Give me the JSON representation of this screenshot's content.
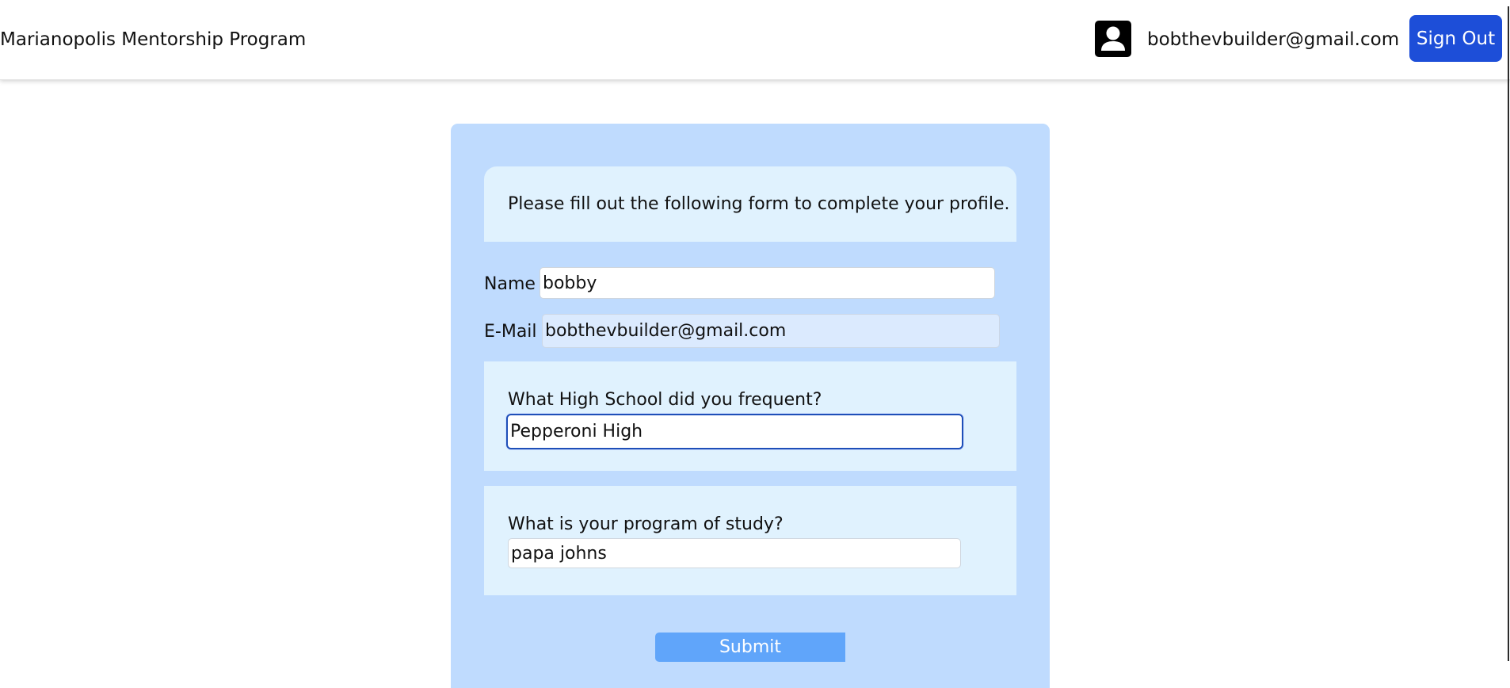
{
  "header": {
    "app_title": "Marianopolis Mentorship Program",
    "user_icon": "user-avatar-icon",
    "user_email": "bobthevbuilder@gmail.com",
    "sign_out_label": "Sign Out",
    "sign_out_color": "#1d4ed8"
  },
  "form": {
    "intro": "Please fill out the following form to complete your profile.",
    "name_label": "Name",
    "name_value": "bobby",
    "email_label": "E-Mail",
    "email_value": "bobthevbuilder@gmail.com",
    "high_school_question": "What High School did you frequent?",
    "high_school_value": "Pepperoni High",
    "program_question": "What is your program of study?",
    "program_value": "papa johns",
    "submit_label": "Submit"
  },
  "colors": {
    "card_background": "#bfdbfe",
    "panel_background": "#e0f2fe",
    "submit_background": "#60a5fa"
  }
}
